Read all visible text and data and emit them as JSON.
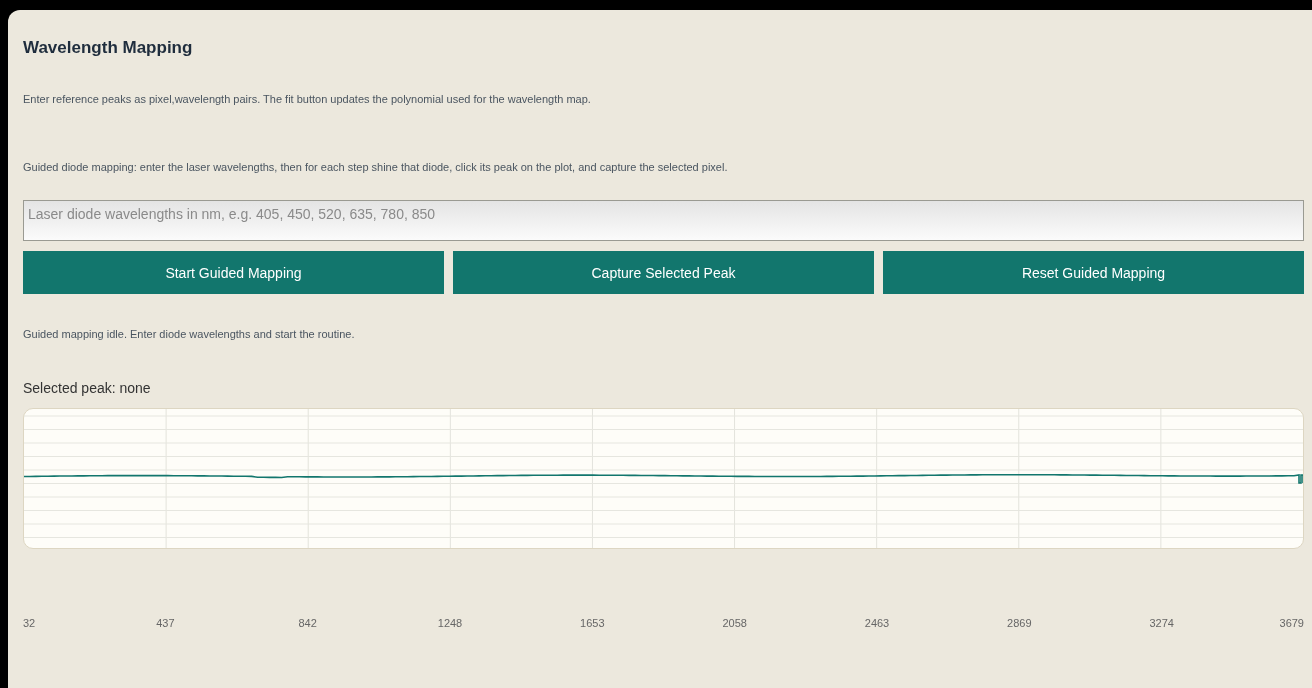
{
  "title": "Wavelength Mapping",
  "intro": "Enter reference peaks as pixel,wavelength pairs. The fit button updates the polynomial used for the wavelength map.",
  "guide": "Guided diode mapping: enter the laser wavelengths, then for each step shine that diode, click its peak on the plot, and capture the selected pixel.",
  "wavelength_field": {
    "placeholder": "Laser diode wavelengths in nm, e.g. 405, 450, 520, 635, 780, 850"
  },
  "buttons": [
    "Start Guided Mapping",
    "Capture Selected Peak",
    "Reset Guided Mapping"
  ],
  "status": "Guided mapping idle. Enter diode wavelengths and start the routine.",
  "selected_peak": "Selected peak: none",
  "x_tick_labels": [
    "32",
    "437",
    "842",
    "1248",
    "1653",
    "2058",
    "2463",
    "2869",
    "3274",
    "3679"
  ]
}
